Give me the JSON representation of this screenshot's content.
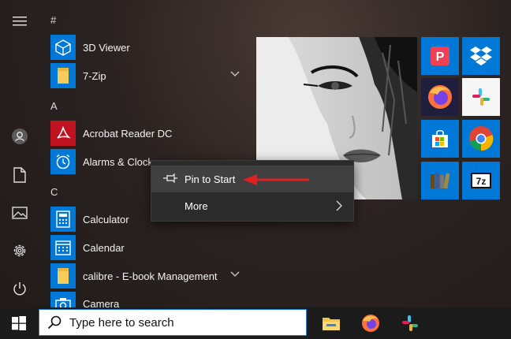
{
  "sections": {
    "hash": "#",
    "a": "A",
    "c": "C"
  },
  "apps": [
    {
      "label": "3D Viewer",
      "icon": "3d-viewer-icon",
      "color": "#0078d7",
      "expandable": false
    },
    {
      "label": "7-Zip",
      "icon": "folder-icon",
      "color": "#0078d7",
      "expandable": true
    },
    {
      "label": "Acrobat Reader DC",
      "icon": "acrobat-icon",
      "color": "#c1121f",
      "expandable": false
    },
    {
      "label": "Alarms & Clock",
      "icon": "alarm-clock-icon",
      "color": "#0078d7",
      "expandable": false
    },
    {
      "label": "Calculator",
      "icon": "calculator-icon",
      "color": "#0078d7",
      "expandable": false
    },
    {
      "label": "Calendar",
      "icon": "calendar-icon",
      "color": "#0078d7",
      "expandable": false
    },
    {
      "label": "calibre - E-book Management",
      "icon": "folder-icon",
      "color": "#0078d7",
      "expandable": true
    },
    {
      "label": "Camera",
      "icon": "camera-icon",
      "color": "#0078d7",
      "expandable": false
    }
  ],
  "context_menu": {
    "pin_label": "Pin to Start",
    "more_label": "More"
  },
  "taskbar": {
    "search_placeholder": "Type here to search"
  },
  "colors": {
    "accent": "#0078d7",
    "highlight_arrow": "#e02020",
    "search_border": "#2a7bd6"
  }
}
